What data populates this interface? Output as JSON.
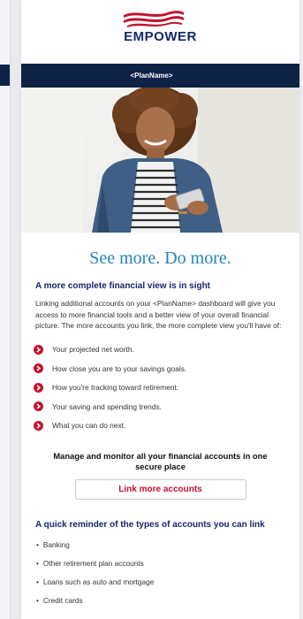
{
  "brand": {
    "name": "EMPOWER",
    "colors": {
      "navy": "#0e2246",
      "brand_red": "#c4122f",
      "headline_blue": "#1f87b8"
    }
  },
  "plan_bar": {
    "label": "<PlanName>"
  },
  "hero": {
    "alt": "woman-using-phone"
  },
  "headline": "See more. Do more.",
  "section1": {
    "title": "A more complete financial view is in sight",
    "intro": "Linking additional accounts on your <PlanName> dashboard will give you access to more financial tools and a better view of your overall financial picture. The more accounts you link, the more complete view you'll have of:",
    "bullets": [
      "Your projected net worth.",
      "How close you are to your savings goals.",
      "How you're tracking toward retirement.",
      "Your saving and spending trends.",
      "What you can do next."
    ]
  },
  "cta": {
    "text": "Manage and monitor all your financial accounts in one secure place",
    "button_label": "Link more accounts"
  },
  "section2": {
    "title": "A quick reminder of the types of accounts you can link",
    "items": [
      "Banking",
      "Other retirement plan accounts",
      "Loans such as auto and mortgage",
      "Credit cards"
    ]
  }
}
